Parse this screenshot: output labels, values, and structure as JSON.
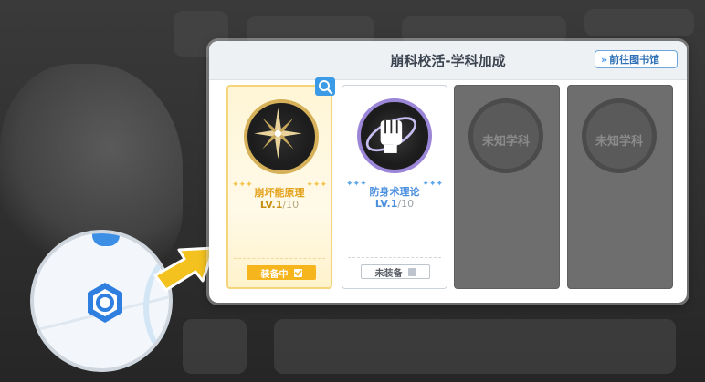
{
  "panel": {
    "title": "崩科校活-学科加成",
    "library_button": "前往图书馆",
    "library_icon": "double-chevron-right-icon"
  },
  "subjects": [
    {
      "name": "崩坏能原理",
      "level_prefix": "LV.1",
      "level_max": "/10",
      "status": "装备中",
      "equipped": true,
      "badge_icon": "star-crystal-icon",
      "accent": "#e3a21c"
    },
    {
      "name": "防身术理论",
      "level_prefix": "LV.1",
      "level_max": "/10",
      "status": "未装备",
      "equipped": false,
      "badge_icon": "fist-orbit-icon",
      "accent": "#4b8fdf"
    },
    {
      "name": "未知学科",
      "locked": true
    },
    {
      "name": "未知学科",
      "locked": true
    }
  ],
  "zoom_icon": "magnifier-icon",
  "colors": {
    "gold": "#f6b51d",
    "blue": "#3b9be6",
    "locked": "#6e6e6e"
  }
}
